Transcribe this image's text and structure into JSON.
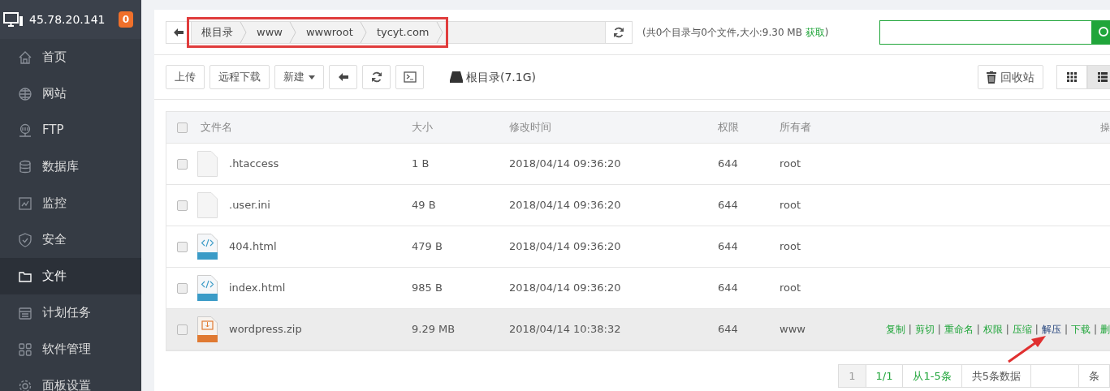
{
  "server": {
    "ip": "45.78.20.141",
    "badge": "0"
  },
  "sidebar": {
    "items": [
      {
        "label": "首页",
        "selected": false
      },
      {
        "label": "网站",
        "selected": false
      },
      {
        "label": "FTP",
        "selected": false
      },
      {
        "label": "数据库",
        "selected": false
      },
      {
        "label": "监控",
        "selected": false
      },
      {
        "label": "安全",
        "selected": false
      },
      {
        "label": "文件",
        "selected": true
      },
      {
        "label": "计划任务",
        "selected": false
      },
      {
        "label": "软件管理",
        "selected": false
      },
      {
        "label": "面板设置",
        "selected": false
      }
    ]
  },
  "path_bar": {
    "crumbs": [
      "根目录",
      "www",
      "wwwroot",
      "tycyt.com"
    ],
    "highlighted": true,
    "summary": "(共0个目录与0个文件,大小:9.30 MB",
    "summary_link": "获取",
    "summary_end": ")"
  },
  "toolbar": {
    "buttons": [
      {
        "kind": "text",
        "label": "上传"
      },
      {
        "kind": "text",
        "label": "远程下载"
      },
      {
        "kind": "dropdown",
        "label": "新建"
      },
      {
        "kind": "back"
      },
      {
        "kind": "refresh"
      },
      {
        "kind": "terminal"
      }
    ],
    "disk": "根目录(7.1G)",
    "recycle": "回收站",
    "views": [
      {
        "kind": "grid",
        "selected": false
      },
      {
        "kind": "list",
        "selected": true
      }
    ]
  },
  "table": {
    "select_all": {
      "checked": false
    },
    "columns": [
      "文件名",
      "大小",
      "修改时间",
      "权限",
      "所有者",
      "操"
    ],
    "rows": [
      {
        "kind": "blank",
        "name": ".htaccess",
        "size": "1 B",
        "modified": "2018/04/14 09:36:20",
        "permissions": "644",
        "owner": "root",
        "checked": false,
        "highlighted": false,
        "actions": []
      },
      {
        "kind": "blank",
        "name": ".user.ini",
        "size": "49 B",
        "modified": "2018/04/14 09:36:20",
        "permissions": "644",
        "owner": "root",
        "checked": false,
        "highlighted": false,
        "actions": []
      },
      {
        "kind": "html",
        "name": "404.html",
        "size": "479 B",
        "modified": "2018/04/14 09:36:20",
        "permissions": "644",
        "owner": "root",
        "checked": false,
        "highlighted": false,
        "actions": []
      },
      {
        "kind": "html",
        "name": "index.html",
        "size": "985 B",
        "modified": "2018/04/14 09:36:20",
        "permissions": "644",
        "owner": "root",
        "checked": false,
        "highlighted": false,
        "actions": []
      },
      {
        "kind": "zip",
        "name": "wordpress.zip",
        "size": "9.29 MB",
        "modified": "2018/04/14 10:38:32",
        "permissions": "644",
        "owner": "www",
        "checked": false,
        "highlighted": true,
        "actions": [
          {
            "kind": "link",
            "label": "复制",
            "selected": false
          },
          {
            "kind": "separator",
            "label": "|"
          },
          {
            "kind": "link",
            "label": "剪切",
            "selected": false
          },
          {
            "kind": "separator",
            "label": "|"
          },
          {
            "kind": "link",
            "label": "重命名",
            "selected": false
          },
          {
            "kind": "separator",
            "label": "|"
          },
          {
            "kind": "link",
            "label": "权限",
            "selected": false
          },
          {
            "kind": "separator",
            "label": "|"
          },
          {
            "kind": "link",
            "label": "压缩",
            "selected": false
          },
          {
            "kind": "separator",
            "label": "|"
          },
          {
            "kind": "link",
            "label": "解压",
            "selected": true
          },
          {
            "kind": "separator",
            "label": "|"
          },
          {
            "kind": "link",
            "label": "下载",
            "selected": false
          },
          {
            "kind": "separator",
            "label": "|"
          },
          {
            "kind": "link",
            "label": "删",
            "selected": false
          }
        ]
      }
    ]
  },
  "pagination": {
    "pages": [
      {
        "label": "1",
        "kind": "link",
        "selected": true
      },
      {
        "label": "1/1",
        "kind": "link",
        "selected": false
      },
      {
        "label": "从1-5条",
        "kind": "link",
        "selected": false
      },
      {
        "label": "共5条数据",
        "kind": "text"
      }
    ],
    "per_page_suffix": "条"
  },
  "annotation": {
    "arrow": true
  }
}
